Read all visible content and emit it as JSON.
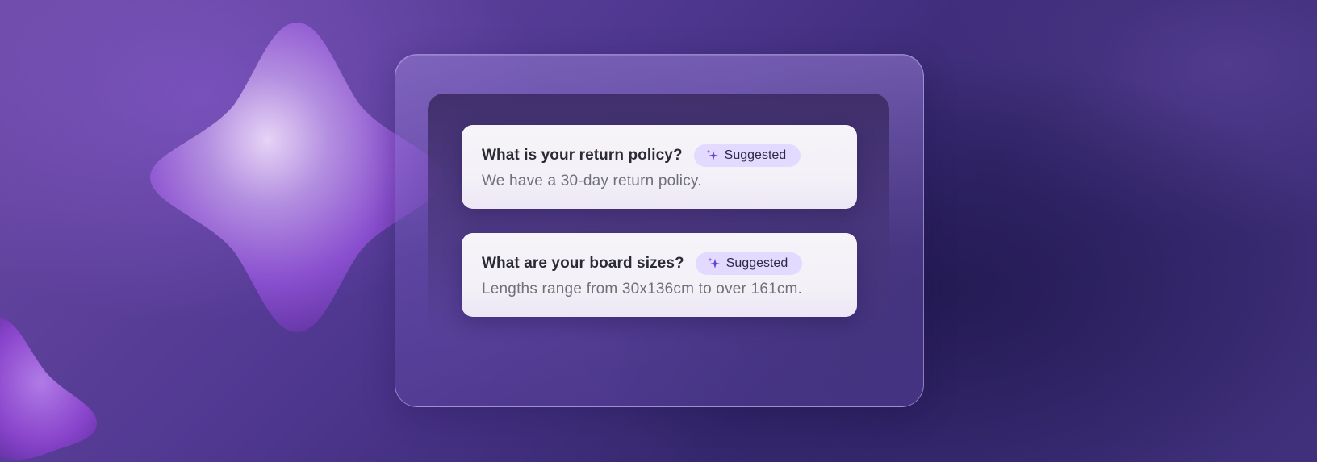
{
  "faq": {
    "items": [
      {
        "question": "What is your return policy?",
        "badge": "Suggested",
        "answer": "We have a 30-day return policy."
      },
      {
        "question": "What are your board sizes?",
        "badge": "Suggested",
        "answer": "Lengths range from 30x136cm to over 161cm."
      }
    ]
  },
  "colors": {
    "background": "#4f3790",
    "badge_background": "#e2daff",
    "sparkle_icon": "#6a3fd6"
  },
  "icons": {
    "badge_icon": "sparkle-icon",
    "decorative_shape": "four-point-star"
  }
}
